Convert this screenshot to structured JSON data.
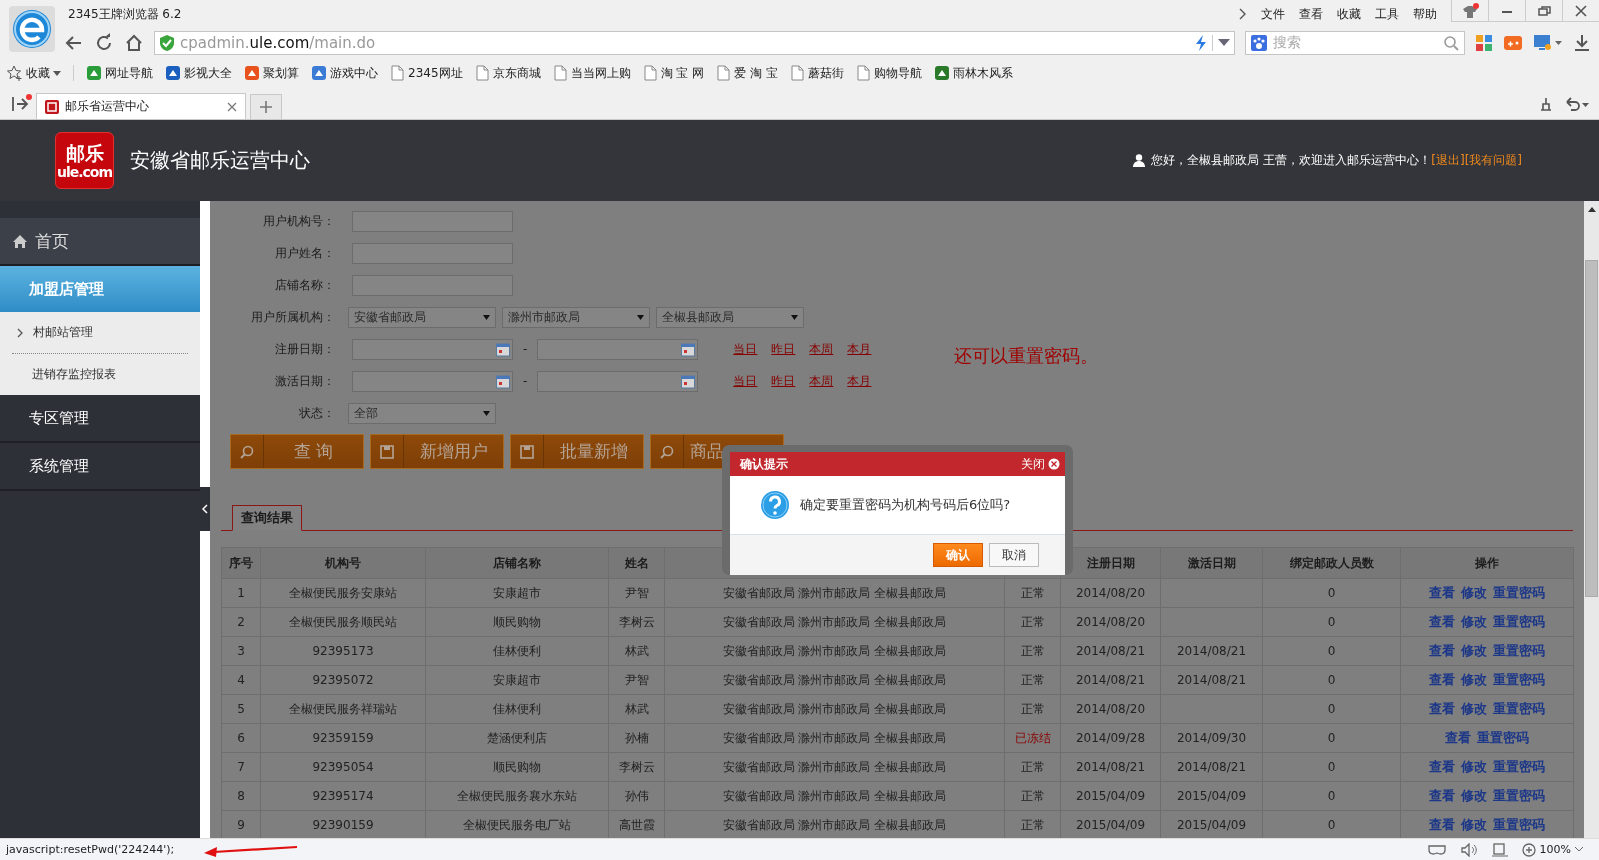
{
  "browser": {
    "title": "2345王牌浏览器 6.2",
    "menu": [
      "文件",
      "查看",
      "收藏",
      "工具",
      "帮助"
    ],
    "url": "cpadmin.**ule.com**/main.do",
    "search": {
      "placeholder": "搜索"
    },
    "favorites": "收藏",
    "bookmarks": [
      {
        "label": "网址导航",
        "kind": "site"
      },
      {
        "label": "影视大全",
        "kind": "site"
      },
      {
        "label": "聚划算",
        "kind": "site"
      },
      {
        "label": "游戏中心",
        "kind": "site"
      },
      {
        "label": "2345网址",
        "kind": "page"
      },
      {
        "label": "京东商城",
        "kind": "page"
      },
      {
        "label": "当当网上购",
        "kind": "page"
      },
      {
        "label": "淘 宝 网",
        "kind": "page"
      },
      {
        "label": "爱 淘 宝",
        "kind": "page"
      },
      {
        "label": "蘑菇街",
        "kind": "page"
      },
      {
        "label": "购物导航",
        "kind": "page"
      },
      {
        "label": "雨林木风系",
        "kind": "site"
      }
    ],
    "tabs": [
      {
        "label": "邮乐省运营中心",
        "selected": true
      }
    ]
  },
  "header": {
    "logo_top": "邮乐",
    "logo_bottom": "ule.com",
    "title": "安徽省邮乐运营中心",
    "greeting": "您好，全椒县邮政局  王蕾，欢迎进入邮乐运营中心！",
    "links": [
      "[退出]",
      "[我有问题]"
    ]
  },
  "sidebar": {
    "items": [
      {
        "label": "首页",
        "kind": "home",
        "selected": false,
        "expanded": false
      },
      {
        "label": "加盟店管理",
        "kind": "section",
        "selected": true,
        "expanded": true,
        "children": [
          {
            "label": "村邮站管理",
            "expandable": true
          },
          {
            "label": "进销存监控报表",
            "expandable": false
          }
        ]
      },
      {
        "label": "专区管理",
        "kind": "section",
        "selected": false,
        "expanded": false
      },
      {
        "label": "系统管理",
        "kind": "section",
        "selected": false,
        "expanded": false
      }
    ]
  },
  "form": {
    "fields": [
      {
        "label": "用户机构号：",
        "kind": "text"
      },
      {
        "label": "用户姓名：",
        "kind": "text"
      },
      {
        "label": "店铺名称：",
        "kind": "text"
      },
      {
        "label": "用户所属机构：",
        "kind": "selects",
        "values": [
          "安徽省邮政局",
          "滁州市邮政局",
          "全椒县邮政局"
        ]
      },
      {
        "label": "注册日期：",
        "kind": "daterange",
        "separator": "-",
        "quick": [
          "当日",
          "昨日",
          "本周",
          "本月"
        ]
      },
      {
        "label": "激活日期：",
        "kind": "daterange",
        "separator": "-",
        "quick": [
          "当日",
          "昨日",
          "本周",
          "本月"
        ]
      },
      {
        "label": "状态：",
        "kind": "select",
        "values": [
          "全部"
        ]
      }
    ],
    "buttons": [
      {
        "label": "查 询",
        "kind": "search"
      },
      {
        "label": "新增用户",
        "kind": "save"
      },
      {
        "label": "批量新增",
        "kind": "save"
      },
      {
        "label": "商品",
        "kind": "search"
      }
    ]
  },
  "annotation": "还可以重置密码。",
  "results": {
    "tab": "查询结果",
    "columns": [
      "序号",
      "机构号",
      "店铺名称",
      "姓名",
      "注册日期",
      "激活日期",
      "绑定邮政人员数",
      "操作"
    ],
    "rows": [
      {
        "no": "1",
        "org_id": "全椒便民服务安康站",
        "shop": "安康超市",
        "name": "尹智",
        "org": "安徽省邮政局 滁州市邮政局 全椒县邮政局",
        "status": "正常",
        "frozen": false,
        "registered": "2014/08/20",
        "bound": "0",
        "actions": [
          "查看",
          "修改",
          "重置密码"
        ]
      },
      {
        "no": "2",
        "org_id": "全椒便民服务顺民站",
        "shop": "顺民购物",
        "name": "李树云",
        "org": "安徽省邮政局 滁州市邮政局 全椒县邮政局",
        "status": "正常",
        "frozen": false,
        "registered": "2014/08/20",
        "bound": "0",
        "actions": [
          "查看",
          "修改",
          "重置密码"
        ]
      },
      {
        "no": "3",
        "org_id": "92395173",
        "shop": "佳林便利",
        "name": "林武",
        "org": "安徽省邮政局 滁州市邮政局 全椒县邮政局",
        "status": "正常",
        "frozen": false,
        "registered": "2014/08/21",
        "activated": "2014/08/21",
        "bound": "0",
        "actions": [
          "查看",
          "修改",
          "重置密码"
        ]
      },
      {
        "no": "4",
        "org_id": "92395072",
        "shop": "安康超市",
        "name": "尹智",
        "org": "安徽省邮政局 滁州市邮政局 全椒县邮政局",
        "status": "正常",
        "frozen": false,
        "registered": "2014/08/21",
        "activated": "2014/08/21",
        "bound": "0",
        "actions": [
          "查看",
          "修改",
          "重置密码"
        ]
      },
      {
        "no": "5",
        "org_id": "全椒便民服务祥瑞站",
        "shop": "佳林便利",
        "name": "林武",
        "org": "安徽省邮政局 滁州市邮政局 全椒县邮政局",
        "status": "正常",
        "frozen": false,
        "registered": "2014/08/20",
        "bound": "0",
        "actions": [
          "查看",
          "修改",
          "重置密码"
        ]
      },
      {
        "no": "6",
        "org_id": "92359159",
        "shop": "楚涵便利店",
        "name": "孙楠",
        "org": "安徽省邮政局 滁州市邮政局 全椒县邮政局",
        "status": "已冻结",
        "frozen": true,
        "registered": "2014/09/28",
        "activated": "2014/09/30",
        "bound": "0",
        "actions": [
          "查看",
          "重置密码"
        ]
      },
      {
        "no": "7",
        "org_id": "92395054",
        "shop": "顺民购物",
        "name": "李树云",
        "org": "安徽省邮政局 滁州市邮政局 全椒县邮政局",
        "status": "正常",
        "frozen": false,
        "registered": "2014/08/21",
        "activated": "2014/08/21",
        "bound": "0",
        "actions": [
          "查看",
          "修改",
          "重置密码"
        ]
      },
      {
        "no": "8",
        "org_id": "92395174",
        "shop": "全椒便民服务襄水东站",
        "name": "孙伟",
        "org": "安徽省邮政局 滁州市邮政局 全椒县邮政局",
        "status": "正常",
        "frozen": false,
        "registered": "2015/04/09",
        "activated": "2015/04/09",
        "bound": "0",
        "actions": [
          "查看",
          "修改",
          "重置密码"
        ]
      },
      {
        "no": "9",
        "org_id": "92390159",
        "shop": "全椒便民服务电厂站",
        "name": "高世霞",
        "org": "安徽省邮政局 滁州市邮政局 全椒县邮政局",
        "status": "正常",
        "frozen": false,
        "registered": "2015/04/09",
        "activated": "2015/04/09",
        "bound": "0",
        "actions": [
          "查看",
          "修改",
          "重置密码"
        ]
      }
    ]
  },
  "dialog": {
    "title": "确认提示",
    "close": "关闭",
    "message": "确定要重置密码为机构号码后6位吗?",
    "buttons": [
      {
        "label": "确认",
        "primary": true
      },
      {
        "label": "取消",
        "primary": false
      }
    ]
  },
  "status_bar": {
    "text": "javascript:resetPwd('224244');",
    "zoom": "100%"
  }
}
